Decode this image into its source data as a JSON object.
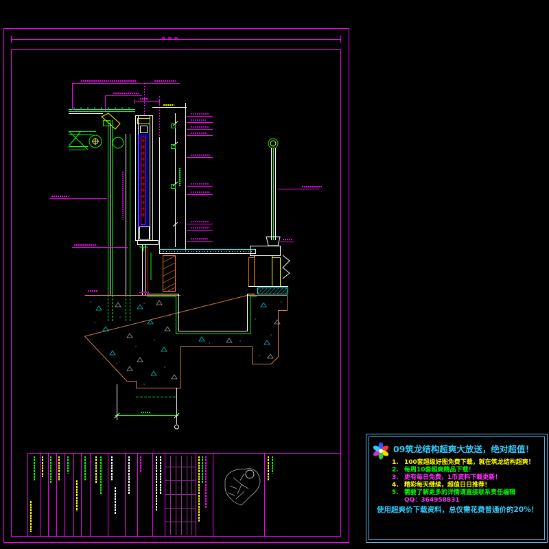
{
  "colors": {
    "background": "#000000",
    "frame": "#ff00ff",
    "ad_border": "#5fb7e8",
    "ad_heading": "#33ccff",
    "ad_qq": "#ff33ff",
    "ad_footer": "#33ccff"
  },
  "icons": {
    "ad_logo": "pinwheel-logo-icon"
  },
  "ad": {
    "heading": "09筑龙结构超爽大放送，绝对超值！",
    "items": [
      {
        "num": "1.",
        "text": "100套超级好图免费下载，就在筑龙结构超爽！",
        "color": "#ffff00"
      },
      {
        "num": "2.",
        "text": "每周10套超爽精品下载！",
        "color": "#00ff00"
      },
      {
        "num": "3.",
        "text": "更有每日免费，1币资料下载更新！",
        "color": "#ff33ff"
      },
      {
        "num": "4.",
        "text": "精彩每天继续，超值日日推荐！",
        "color": "#ffff00"
      },
      {
        "num": "5.",
        "text": "需要了解更多的详情请直接联系责任编辑",
        "color": "#00ff00"
      }
    ],
    "qq": "QQ：364958831",
    "footer": "使用超爽价下载资料，总仅需花费普通价的20%！"
  }
}
